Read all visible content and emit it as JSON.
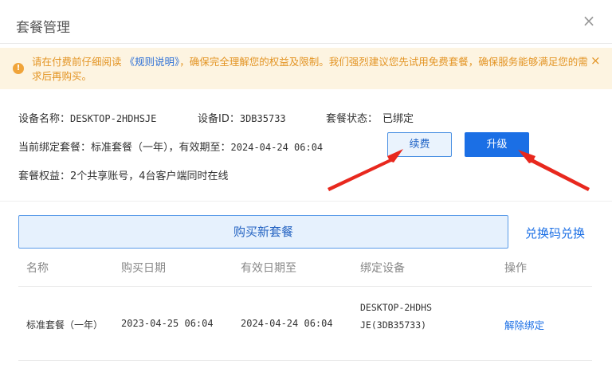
{
  "dialog": {
    "title": "套餐管理",
    "close_glyph": "×"
  },
  "alert": {
    "icon_glyph": "!",
    "text_before": "请在付费前仔细阅读",
    "link": "《规则说明》",
    "text_after": "，确保完全理解您的权益及限制。我们强烈建议您先试用免费套餐，确保服务能够满足您的需求后再购买。",
    "close_glyph": "×"
  },
  "device": {
    "name_label": "设备名称：",
    "name_value": "DESKTOP-2HDHSJE",
    "id_label": "设备ID：",
    "id_value": "3DB35733",
    "status_label": "套餐状态：",
    "status_value": "已绑定",
    "bound_plan_label": "当前绑定套餐：",
    "bound_plan_value": "标准套餐（一年）",
    "expiry_label": "，有效期至：",
    "expiry_value": "2024-04-24 06:04",
    "rights_label": "套餐权益：",
    "rights_value": "2个共享账号，4台客户端同时在线"
  },
  "actions": {
    "renew_label": "续费",
    "upgrade_label": "升级",
    "buy_new_label": "购买新套餐",
    "redeem_label": "兑换码兑换"
  },
  "table": {
    "headers": [
      "名称",
      "购买日期",
      "有效日期至",
      "绑定设备",
      "操作"
    ],
    "rows": [
      {
        "name": "标准套餐（一年）",
        "purchase_date": "2023-04-25 06:04",
        "valid_until": "2024-04-24 06:04",
        "device": "DESKTOP-2HDHSJE(3DB35733)",
        "action": "解除绑定"
      }
    ]
  },
  "colors": {
    "accent": "#1b6fe5",
    "warning": "#e39424",
    "annotation_arrow": "#e8281e"
  }
}
